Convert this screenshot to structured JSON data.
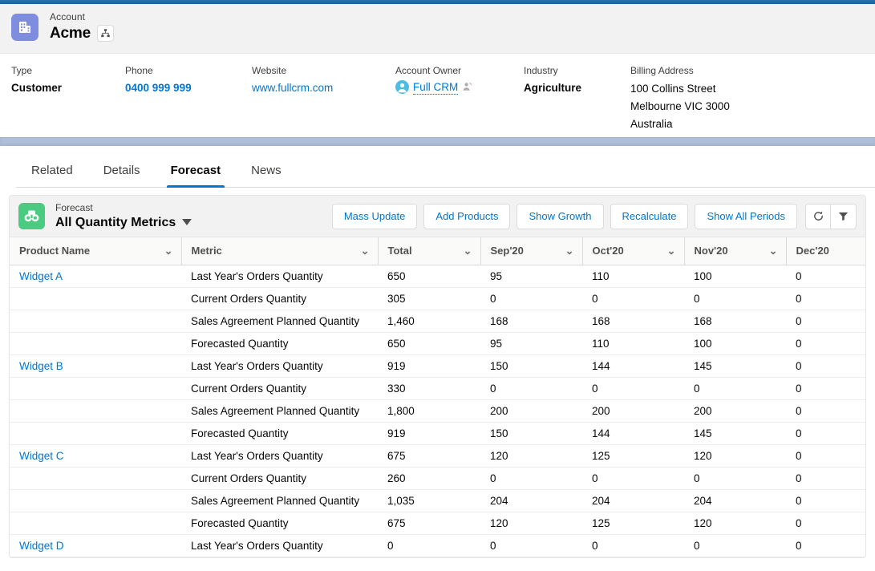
{
  "record_header": {
    "object_label": "Account",
    "title": "Acme",
    "app_icon": "account-building-icon",
    "hierarchy_icon": "hierarchy-icon"
  },
  "detail_fields": [
    {
      "label": "Type",
      "value": "Customer",
      "kind": "text"
    },
    {
      "label": "Phone",
      "value": "0400 999 999",
      "kind": "link"
    },
    {
      "label": "Website",
      "value": "www.fullcrm.com",
      "kind": "link"
    },
    {
      "label": "Account Owner",
      "value": "Full CRM",
      "kind": "owner",
      "avatar_icon": "user-avatar-icon",
      "change_owner_icon": "change-owner-icon"
    },
    {
      "label": "Industry",
      "value": "Agriculture",
      "kind": "text"
    },
    {
      "label": "Billing Address",
      "kind": "address",
      "lines": [
        "100 Collins Street",
        "Melbourne VIC 3000",
        "Australia"
      ]
    }
  ],
  "tabs": [
    {
      "label": "Related",
      "active": false
    },
    {
      "label": "Details",
      "active": false
    },
    {
      "label": "Forecast",
      "active": true
    },
    {
      "label": "News",
      "active": false
    }
  ],
  "forecast_card": {
    "icon": "binoculars-icon",
    "subtitle": "Forecast",
    "title": "All Quantity Metrics",
    "title_caret_icon": "caret-down-icon",
    "buttons": [
      "Mass Update",
      "Add Products",
      "Show Growth",
      "Recalculate",
      "Show All Periods"
    ],
    "icon_buttons": [
      {
        "name": "refresh-icon",
        "title": "Refresh"
      },
      {
        "name": "filter-icon",
        "title": "Filter"
      }
    ]
  },
  "table": {
    "columns": [
      "Product Name",
      "Metric",
      "Total",
      "Sep'20",
      "Oct'20",
      "Nov'20",
      "Dec'20"
    ],
    "column_menu_icon": "chevron-down-icon",
    "rows": [
      {
        "product": "Widget A",
        "metric": "Last Year's Orders Quantity",
        "total": "650",
        "sep20": "95",
        "oct20": "110",
        "nov20": "100",
        "dec20": "0"
      },
      {
        "product": "",
        "metric": "Current Orders Quantity",
        "total": "305",
        "sep20": "0",
        "oct20": "0",
        "nov20": "0",
        "dec20": "0"
      },
      {
        "product": "",
        "metric": "Sales Agreement Planned Quantity",
        "total": "1,460",
        "sep20": "168",
        "oct20": "168",
        "nov20": "168",
        "dec20": "0"
      },
      {
        "product": "",
        "metric": "Forecasted Quantity",
        "total": "650",
        "sep20": "95",
        "oct20": "110",
        "nov20": "100",
        "dec20": "0"
      },
      {
        "product": "Widget B",
        "metric": "Last Year's Orders Quantity",
        "total": "919",
        "sep20": "150",
        "oct20": "144",
        "nov20": "145",
        "dec20": "0"
      },
      {
        "product": "",
        "metric": "Current Orders Quantity",
        "total": "330",
        "sep20": "0",
        "oct20": "0",
        "nov20": "0",
        "dec20": "0"
      },
      {
        "product": "",
        "metric": "Sales Agreement Planned Quantity",
        "total": "1,800",
        "sep20": "200",
        "oct20": "200",
        "nov20": "200",
        "dec20": "0"
      },
      {
        "product": "",
        "metric": "Forecasted Quantity",
        "total": "919",
        "sep20": "150",
        "oct20": "144",
        "nov20": "145",
        "dec20": "0"
      },
      {
        "product": "Widget C",
        "metric": "Last Year's Orders Quantity",
        "total": "675",
        "sep20": "120",
        "oct20": "125",
        "nov20": "120",
        "dec20": "0"
      },
      {
        "product": "",
        "metric": "Current Orders Quantity",
        "total": "260",
        "sep20": "0",
        "oct20": "0",
        "nov20": "0",
        "dec20": "0"
      },
      {
        "product": "",
        "metric": "Sales Agreement Planned Quantity",
        "total": "1,035",
        "sep20": "204",
        "oct20": "204",
        "nov20": "204",
        "dec20": "0"
      },
      {
        "product": "",
        "metric": "Forecasted Quantity",
        "total": "675",
        "sep20": "120",
        "oct20": "125",
        "nov20": "120",
        "dec20": "0"
      },
      {
        "product": "Widget D",
        "metric": "Last Year's Orders Quantity",
        "total": "0",
        "sep20": "0",
        "oct20": "0",
        "nov20": "0",
        "dec20": "0"
      }
    ]
  },
  "colors": {
    "brand_blue": "#0176d3",
    "app_icon_purple": "#7f8de1",
    "forecast_green": "#4bca81",
    "top_strip": "#1b5f9e",
    "band_divider": "#aebfd9"
  }
}
